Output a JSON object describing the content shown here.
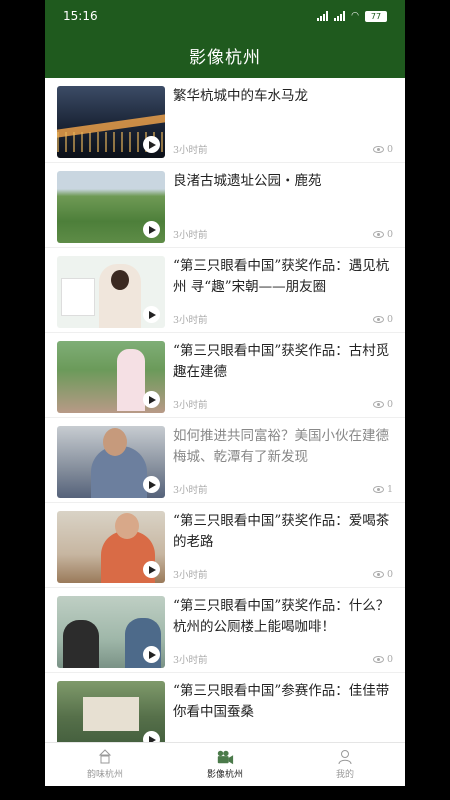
{
  "status": {
    "time": "15:16",
    "battery": "77"
  },
  "header": {
    "title": "影像杭州"
  },
  "videos": [
    {
      "title": "繁华杭城中的车水马龙",
      "time": "3小时前",
      "views": "0",
      "read": false
    },
    {
      "title": "良渚古城遗址公园・鹿苑",
      "time": "3小时前",
      "views": "0",
      "read": false
    },
    {
      "title": "“第三只眼看中国”获奖作品：遇见杭州 寻“趣”宋朝——朋友圈",
      "time": "3小时前",
      "views": "0",
      "read": false
    },
    {
      "title": "“第三只眼看中国”获奖作品：古村觅趣在建德",
      "time": "3小时前",
      "views": "0",
      "read": false
    },
    {
      "title": "如何推进共同富裕？美国小伙在建德梅城、乾潭有了新发现",
      "time": "3小时前",
      "views": "1",
      "read": true
    },
    {
      "title": "“第三只眼看中国”获奖作品：爱喝茶的老路",
      "time": "3小时前",
      "views": "0",
      "read": false
    },
    {
      "title": "“第三只眼看中国”获奖作品：什么？杭州的公厕楼上能喝咖啡！",
      "time": "3小时前",
      "views": "0",
      "read": false
    },
    {
      "title": "“第三只眼看中国”参赛作品：佳佳带你看中国蚕桑",
      "time": "",
      "views": "",
      "read": false
    }
  ],
  "tabs": [
    {
      "label": "韵味杭州",
      "icon": "temple-icon"
    },
    {
      "label": "影像杭州",
      "icon": "video-camera-icon"
    },
    {
      "label": "我的",
      "icon": "user-icon"
    }
  ]
}
